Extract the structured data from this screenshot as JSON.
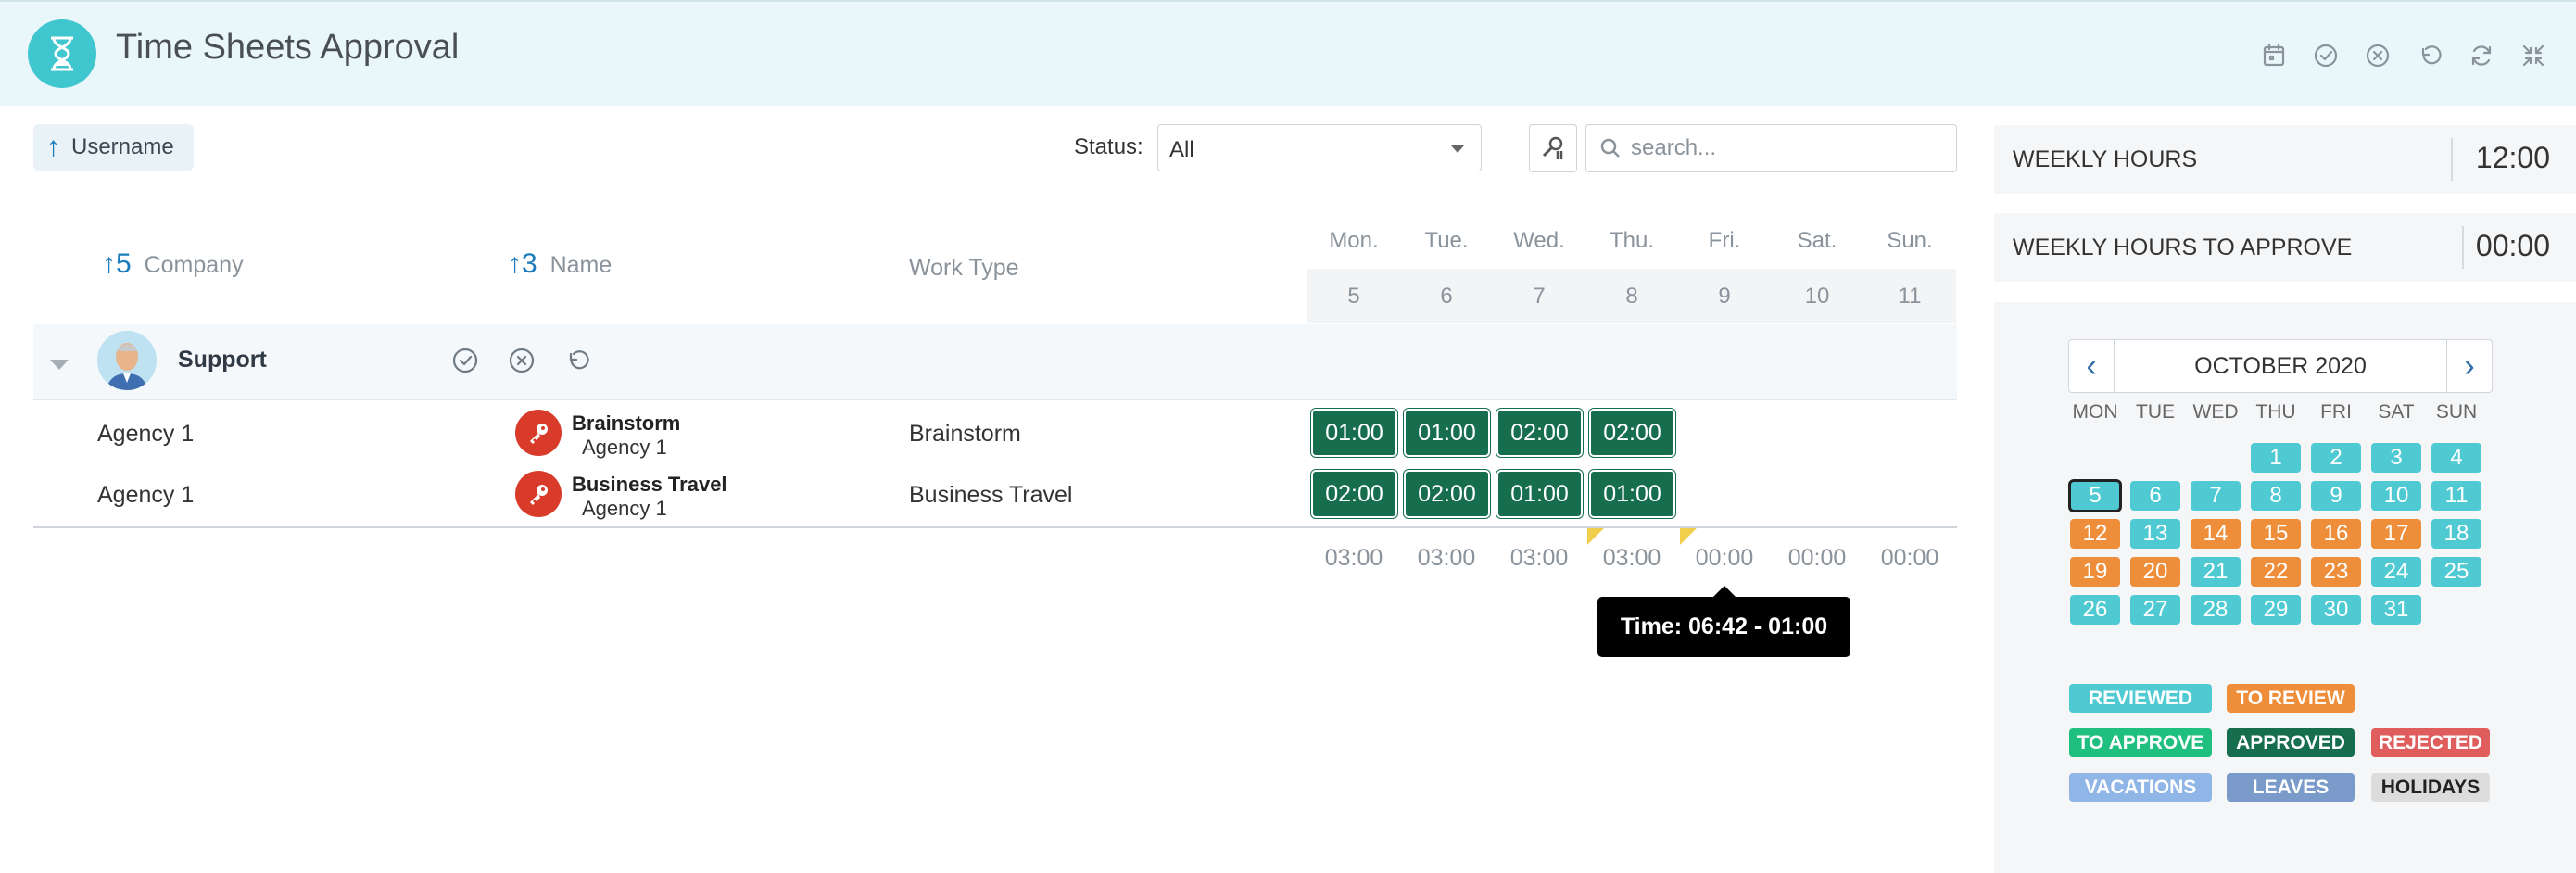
{
  "header": {
    "title": "Time Sheets Approval",
    "actions": [
      "calendar-icon",
      "check-circle-icon",
      "x-circle-icon",
      "undo-icon",
      "refresh-icon",
      "collapse-icon"
    ]
  },
  "toolbar": {
    "sort_label": "Username",
    "status_label": "Status:",
    "status_value": "All",
    "search_placeholder": "search..."
  },
  "columns": {
    "company_sort_index": "5",
    "company": "Company",
    "name_sort_index": "3",
    "name": "Name",
    "work_type": "Work Type",
    "days": [
      {
        "dow": "Mon.",
        "num": "5"
      },
      {
        "dow": "Tue.",
        "num": "6"
      },
      {
        "dow": "Wed.",
        "num": "7"
      },
      {
        "dow": "Thu.",
        "num": "8"
      },
      {
        "dow": "Fri.",
        "num": "9"
      },
      {
        "dow": "Sat.",
        "num": "10"
      },
      {
        "dow": "Sun.",
        "num": "11"
      }
    ]
  },
  "group": {
    "name": "Support"
  },
  "rows": [
    {
      "company": "Agency 1",
      "name": "Brainstorm",
      "sub": "Agency 1",
      "work_type": "Brainstorm",
      "hours": [
        "01:00",
        "01:00",
        "02:00",
        "02:00"
      ]
    },
    {
      "company": "Agency 1",
      "name": "Business Travel",
      "sub": "Agency 1",
      "work_type": "Business Travel",
      "hours": [
        "02:00",
        "02:00",
        "01:00",
        "01:00"
      ]
    }
  ],
  "totals": [
    "03:00",
    "03:00",
    "03:00",
    "03:00",
    "00:00",
    "00:00",
    "00:00"
  ],
  "tooltip": "Time: 06:42 - 01:00",
  "weekly": {
    "hours_label": "WEEKLY HOURS",
    "hours_value": "12:00",
    "approve_label": "WEEKLY HOURS TO APPROVE",
    "approve_value": "00:00"
  },
  "calendar": {
    "title": "OCTOBER 2020",
    "prev": "‹",
    "next": "›",
    "weekdays": [
      "MON",
      "TUE",
      "WED",
      "THU",
      "FRI",
      "SAT",
      "SUN"
    ],
    "first_weekday_index": 3,
    "selected_day": 5,
    "days": [
      {
        "d": "1",
        "s": "rv"
      },
      {
        "d": "2",
        "s": "rv"
      },
      {
        "d": "3",
        "s": "rv"
      },
      {
        "d": "4",
        "s": "rv"
      },
      {
        "d": "5",
        "s": "rv"
      },
      {
        "d": "6",
        "s": "rv"
      },
      {
        "d": "7",
        "s": "rv"
      },
      {
        "d": "8",
        "s": "rv"
      },
      {
        "d": "9",
        "s": "rv"
      },
      {
        "d": "10",
        "s": "rv"
      },
      {
        "d": "11",
        "s": "rv"
      },
      {
        "d": "12",
        "s": "tr"
      },
      {
        "d": "13",
        "s": "rv"
      },
      {
        "d": "14",
        "s": "tr"
      },
      {
        "d": "15",
        "s": "tr"
      },
      {
        "d": "16",
        "s": "tr"
      },
      {
        "d": "17",
        "s": "tr"
      },
      {
        "d": "18",
        "s": "rv"
      },
      {
        "d": "19",
        "s": "tr"
      },
      {
        "d": "20",
        "s": "tr"
      },
      {
        "d": "21",
        "s": "rv"
      },
      {
        "d": "22",
        "s": "tr"
      },
      {
        "d": "23",
        "s": "tr"
      },
      {
        "d": "24",
        "s": "rv"
      },
      {
        "d": "25",
        "s": "rv"
      },
      {
        "d": "26",
        "s": "rv"
      },
      {
        "d": "27",
        "s": "rv"
      },
      {
        "d": "28",
        "s": "rv"
      },
      {
        "d": "29",
        "s": "rv"
      },
      {
        "d": "30",
        "s": "rv"
      },
      {
        "d": "31",
        "s": "rv"
      }
    ]
  },
  "legend": [
    {
      "label": "REVIEWED",
      "color": "#4fcad3",
      "text": "#ffffff"
    },
    {
      "label": "TO REVIEW",
      "color": "#ee8e3b",
      "text": "#ffffff"
    },
    {
      "label": "TO APPROVE",
      "color": "#1fbf80",
      "text": "#ffffff"
    },
    {
      "label": "APPROVED",
      "color": "#176e4e",
      "text": "#ffffff"
    },
    {
      "label": "REJECTED",
      "color": "#e05d5d",
      "text": "#ffffff"
    },
    {
      "label": "VACATIONS",
      "color": "#8fb6e6",
      "text": "#ffffff"
    },
    {
      "label": "LEAVES",
      "color": "#7a9bc9",
      "text": "#ffffff"
    },
    {
      "label": "HOLIDAYS",
      "color": "#dcdcdc",
      "text": "#222222"
    }
  ]
}
